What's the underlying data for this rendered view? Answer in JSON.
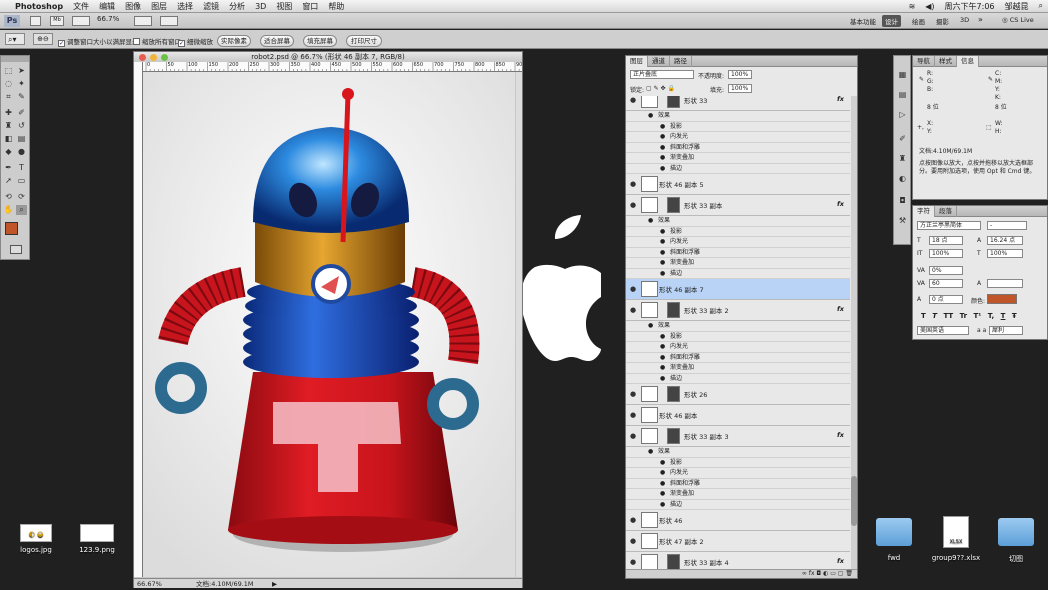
{
  "menubar": {
    "app": "Photoshop",
    "items": [
      "文件",
      "编辑",
      "图像",
      "图层",
      "选择",
      "滤镜",
      "分析",
      "3D",
      "视图",
      "窗口",
      "帮助"
    ],
    "clock": "周六下午7:06",
    "user": "邹越昆"
  },
  "optionsbar": {
    "ps_logo": "Ps",
    "zoom": "66.7%",
    "workspaces": [
      "基本功能",
      "设计",
      "绘画",
      "摄影",
      "3D"
    ],
    "cs_live": "CS Live"
  },
  "toolopts": {
    "chk_resize": "调整窗口大小以满屏显示",
    "chk_all": "缩放所有窗口",
    "chk_scrubby": "细微缩放",
    "btn_actual": "实际像素",
    "btn_fit": "适合屏幕",
    "btn_fill": "填充屏幕",
    "btn_print": "打印尺寸"
  },
  "document": {
    "title": "robot2.psd @ 66.7% (形状 46 副本 7, RGB/8)",
    "zoom": "66.67%",
    "docsize": "文档:4.10M/69.1M",
    "ruler": [
      "0",
      "50",
      "100",
      "150",
      "200",
      "250",
      "300",
      "350",
      "400",
      "450",
      "500",
      "550",
      "600",
      "650",
      "700",
      "750",
      "800",
      "850",
      "900"
    ]
  },
  "layers": {
    "tabs": [
      "图层",
      "通道",
      "路径"
    ],
    "blend": "正片叠底",
    "opacity_label": "不透明度:",
    "opacity": "100%",
    "lock_label": "锁定:",
    "fill_label": "填充:",
    "fill": "100%",
    "effects_label": "效果",
    "effects": [
      "投影",
      "内发光",
      "斜面和浮雕",
      "渐变叠加",
      "描边"
    ],
    "rows": [
      {
        "name": "形状 33",
        "fx": "fx",
        "type": "shape"
      },
      {
        "name": "形状 46 副本 5",
        "type": "plain"
      },
      {
        "name": "形状 33 副本",
        "fx": "fx",
        "type": "shape"
      },
      {
        "name": "形状 46 副本 7",
        "type": "plain",
        "selected": true
      },
      {
        "name": "形状 33 副本 2",
        "fx": "fx",
        "type": "shape"
      },
      {
        "name": "形状 26",
        "type": "shape"
      },
      {
        "name": "形状 46 副本",
        "type": "plain"
      },
      {
        "name": "形状 33 副本 3",
        "fx": "fx",
        "type": "shape"
      },
      {
        "name": "形状 46",
        "type": "plain"
      },
      {
        "name": "形状 47 副本 2",
        "type": "plain"
      },
      {
        "name": "形状 33 副本 4",
        "fx": "fx",
        "type": "shape"
      }
    ]
  },
  "info": {
    "tabs": [
      "导航",
      "样式",
      "信息"
    ],
    "R": "R:",
    "G": "G:",
    "B": "B:",
    "C": "C:",
    "M": "M:",
    "Y": "Y:",
    "K": "K:",
    "bit_left": "8 位",
    "bit_right": "8 位",
    "X": "X:",
    "Y2": "Y:",
    "W": "W:",
    "H": "H:",
    "docsize": "文档:4.10M/69.1M",
    "hint": "点按图像以放大，点按并拖移以放大选框部分。要用附加选项，使用 Opt 和 Cmd 键。"
  },
  "character": {
    "tabs": [
      "字符",
      "段落"
    ],
    "font": "方正兰亭黑简体",
    "style": "-",
    "size": "18 点",
    "leading": "16.24 点",
    "vscale": "100%",
    "hscale": "100%",
    "tracking": "0%",
    "kerning": "60",
    "baseline": "0 点",
    "color_label": "颜色:",
    "color": "#c0552a",
    "language": "美国英语",
    "aa_label": "a a",
    "aa": "犀利",
    "styles": [
      "T",
      "T",
      "TT",
      "Tr",
      "T¹",
      "T,",
      "T",
      "Ŧ"
    ]
  },
  "desktop": {
    "files": [
      "logos.jpg",
      "123.9.png",
      "fwd",
      "group9??.xlsx",
      "切图"
    ]
  },
  "colors": {
    "accent": "#b9d3f6",
    "fg": "#c0552a",
    "bg": "#ffffff"
  }
}
